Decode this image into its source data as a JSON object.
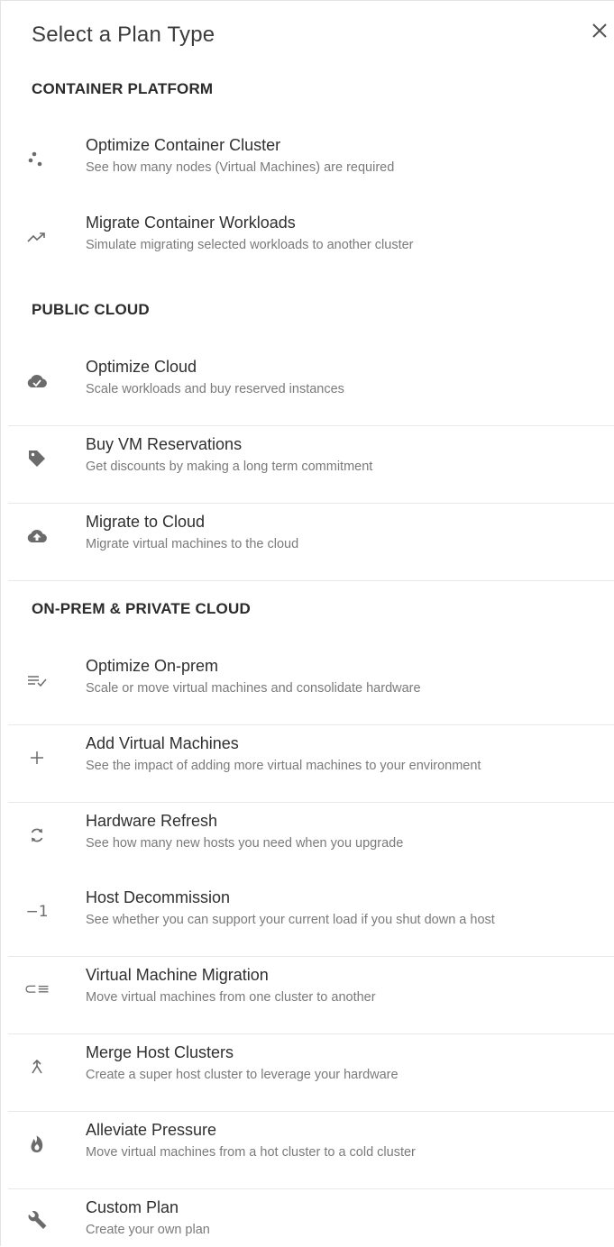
{
  "dialog": {
    "title": "Select a Plan Type",
    "close_icon": "close-icon"
  },
  "sections": [
    {
      "heading": "CONTAINER PLATFORM",
      "items": [
        {
          "name": "Optimize Container Cluster",
          "description": "See how many nodes (Virtual Machines) are required",
          "icon": "nodes-dots-icon"
        },
        {
          "name": "Migrate Container Workloads",
          "description": "Simulate migrating selected workloads to another cluster",
          "icon": "trend-arrow-icon"
        }
      ]
    },
    {
      "heading": "PUBLIC CLOUD",
      "items": [
        {
          "name": "Optimize Cloud",
          "description": "Scale workloads and buy reserved instances",
          "icon": "cloud-check-icon"
        },
        {
          "name": "Buy VM Reservations",
          "description": "Get discounts by making a long term commitment",
          "icon": "tag-icon"
        },
        {
          "name": "Migrate to Cloud",
          "description": "Migrate virtual machines to the cloud",
          "icon": "cloud-upload-icon"
        }
      ]
    },
    {
      "heading": "ON-PREM & PRIVATE CLOUD",
      "items": [
        {
          "name": "Optimize On-prem",
          "description": "Scale or move virtual machines and consolidate hardware",
          "icon": "list-check-icon"
        },
        {
          "name": "Add Virtual Machines",
          "description": "See the impact of adding more virtual machines to your environment",
          "icon": "plus-icon"
        },
        {
          "name": "Hardware Refresh",
          "description": "See how many new hosts you need when you upgrade",
          "icon": "refresh-icon"
        },
        {
          "name": "Host Decommission",
          "description": "See whether you can support your current load if you shut down a host",
          "icon": "minus-one-icon",
          "icon_text": "−1"
        },
        {
          "name": "Virtual Machine Migration",
          "description": "Move virtual machines from one cluster to another",
          "icon": "migrate-list-icon",
          "icon_text": "⊂≡"
        },
        {
          "name": "Merge Host Clusters",
          "description": "Create a super host cluster to leverage your hardware",
          "icon": "merge-icon"
        },
        {
          "name": "Alleviate Pressure",
          "description": "Move virtual machines from a hot cluster to a cold cluster",
          "icon": "flame-icon"
        },
        {
          "name": "Custom Plan",
          "description": "Create your own plan",
          "icon": "wrench-icon"
        }
      ]
    }
  ],
  "colors": {
    "text_primary": "#2f2f2f",
    "text_secondary": "#7a7a7a",
    "icon": "#6b6b6b",
    "divider": "#e8e8e8"
  }
}
